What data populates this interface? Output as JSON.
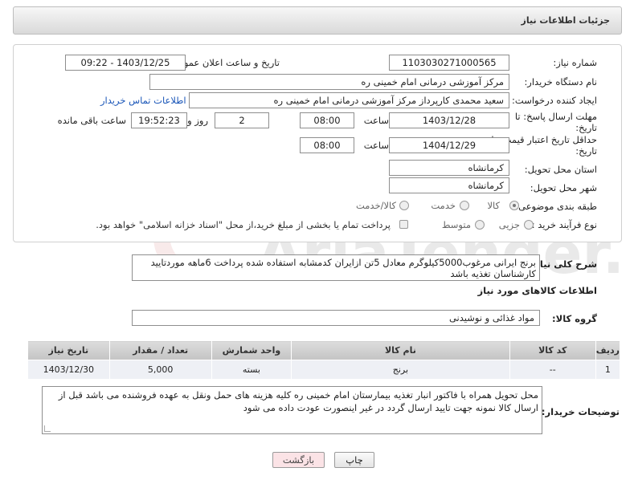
{
  "header": {
    "title": "جزئیات اطلاعات نیاز"
  },
  "form": {
    "need_number_label": "شماره نیاز:",
    "need_number": "1103030271000565",
    "announce_label": "تاریخ و ساعت اعلان عمومی:",
    "announce_value": "1403/12/25 - 09:22",
    "buyer_org_label": "نام دستگاه خریدار:",
    "buyer_org": "مرکز آموزشی درمانی امام خمینی ره",
    "creator_label": "ایجاد کننده درخواست:",
    "creator": "سعید محمدی کارپرداز مرکز آموزشی درمانی امام خمینی ره",
    "contact_link": "اطلاعات تماس خریدار",
    "deadline_label_1": "مهلت ارسال پاسخ: تا",
    "deadline_label_2": "تاریخ:",
    "deadline_date": "1403/12/28",
    "time_label": "ساعت",
    "deadline_time": "08:00",
    "days_value": "2",
    "days_label": "روز و",
    "remaining_time": "19:52:23",
    "remaining_label": "ساعت باقی مانده",
    "validity_label_1": "حداقل تاریخ اعتبار قیمت: تا",
    "validity_label_2": "تاریخ:",
    "validity_date": "1404/12/29",
    "validity_time": "08:00",
    "province_label": "استان محل تحویل:",
    "province": "کرمانشاه",
    "city_label": "شهر محل تحویل:",
    "city": "کرمانشاه",
    "category_label": "طبقه بندی موضوعی:",
    "category_options": [
      "کالا",
      "خدمت",
      "کالا/خدمت"
    ],
    "category_selected": "کالا",
    "process_label": "نوع فرآیند خرید :",
    "process_options": [
      "جزیی",
      "متوسط"
    ],
    "payment_note": "پرداخت تمام یا بخشی از مبلغ خرید،از محل \"اسناد خزانه اسلامی\" خواهد بود."
  },
  "description": {
    "label": "شرح کلی نیاز:",
    "text": "برنج ایرانی مرغوب5000کیلوگرم معادل 5تن ازایران کدمشابه استفاده شده پرداخت 6ماهه موردتایید کارشناسان تغذیه باشد"
  },
  "goods": {
    "section_title": "اطلاعات کالاهای مورد نیاز",
    "group_label": "گروه کالا:",
    "group_value": "مواد غذائی و نوشیدنی",
    "columns": [
      "ردیف",
      "کد کالا",
      "نام کالا",
      "واحد شمارش",
      "تعداد / مقدار",
      "تاریخ نیاز"
    ],
    "rows": [
      {
        "row": "1",
        "code": "--",
        "name": "برنج",
        "unit": "بسته",
        "qty": "5,000",
        "date": "1403/12/30"
      }
    ]
  },
  "buyer_notes": {
    "label": "توضیحات خریدار:",
    "text": "محل تحویل همراه با فاکتور انبار تغذیه بیمارستان امام خمینی ره کلیه هزینه های حمل ونقل به عهده فروشنده می باشد قبل از ارسال کالا نمونه جهت تایید ارسال گردد در غیر اینصورت عودت داده می شود"
  },
  "buttons": {
    "print": "چاپ",
    "back": "بازگشت"
  },
  "watermark": {
    "text": "AriaTender.net"
  }
}
